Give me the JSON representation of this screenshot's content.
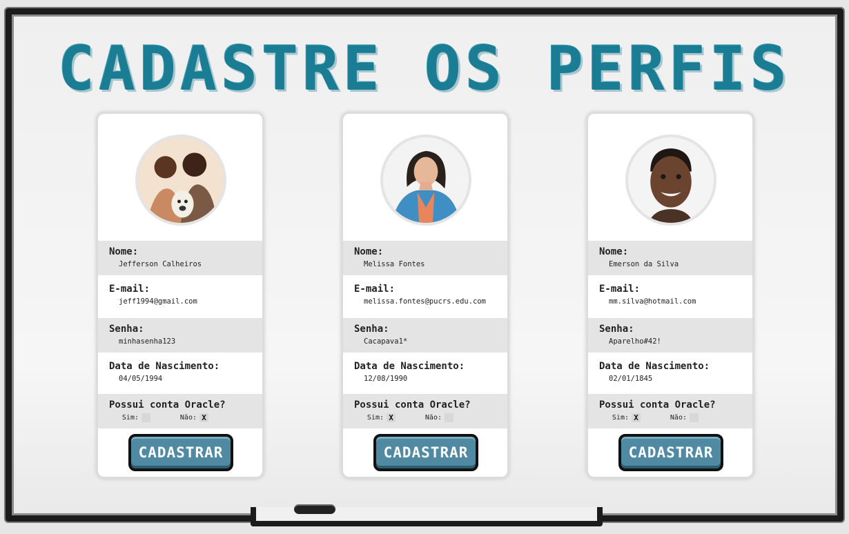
{
  "page": {
    "title": "CADASTRE OS PERFIS"
  },
  "colors": {
    "title": "#1a7d93",
    "button": "#4f89a2",
    "row_shade": "#e4e4e4"
  },
  "labels": {
    "nome": "Nome:",
    "email": "E-mail:",
    "senha": "Senha:",
    "nascimento": "Data de Nascimento:",
    "oracle": "Possui conta Oracle?",
    "sim": "Sim:",
    "nao": "Não:"
  },
  "profiles": [
    {
      "nome": "Jefferson Calheiros",
      "email": "jeff1994@gmail.com",
      "senha": "minhasenha123",
      "nascimento": "04/05/1994",
      "sim_mark": "",
      "nao_mark": "X",
      "button": "CADASTRAR",
      "avatar_icon": "couple-with-dog-photo"
    },
    {
      "nome": "Melissa Fontes",
      "email": "melissa.fontes@pucrs.edu.com",
      "senha": "Cacapava1*",
      "nascimento": "12/08/1990",
      "sim_mark": "X",
      "nao_mark": "",
      "button": "CADASTRAR",
      "avatar_icon": "woman-portrait-photo"
    },
    {
      "nome": "Emerson da Silva",
      "email": "mm.silva@hotmail.com",
      "senha": "Aparelho#42!",
      "nascimento": "02/01/1845",
      "sim_mark": "X",
      "nao_mark": "",
      "button": "CADASTRAR",
      "avatar_icon": "man-portrait-photo"
    }
  ]
}
